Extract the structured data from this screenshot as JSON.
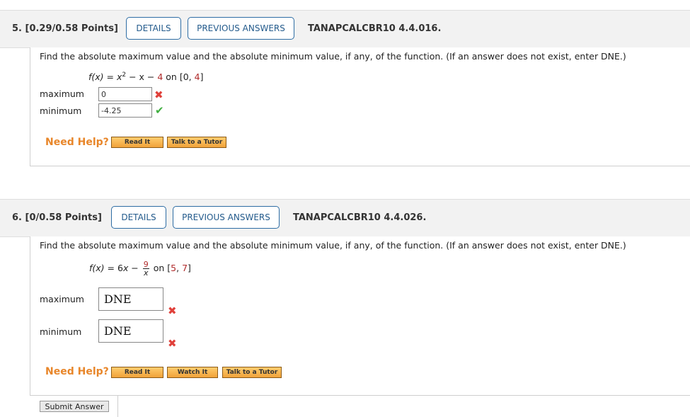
{
  "q5": {
    "number": "5. [0.29/0.58 Points]",
    "details_label": "DETAILS",
    "prev_label": "PREVIOUS ANSWERS",
    "code": "TANAPCALCBR10 4.4.016.",
    "prompt": "Find the absolute maximum value and the absolute minimum value, if any, of the function. (If an answer does not exist, enter DNE.)",
    "fn_prefix": "f(x) = x",
    "fn_exp": "2",
    "fn_mid": " − x − ",
    "fn_const": "4",
    "fn_on": " on [0, ",
    "fn_upper": "4",
    "fn_close": "]",
    "max_label": "maximum",
    "max_value": "0",
    "max_status": "incorrect",
    "min_label": "minimum",
    "min_value": "-4.25",
    "min_status": "correct",
    "need_help": "Need Help?",
    "read_it": "Read It",
    "tutor": "Talk to a Tutor"
  },
  "q6": {
    "number": "6. [0/0.58 Points]",
    "details_label": "DETAILS",
    "prev_label": "PREVIOUS ANSWERS",
    "code": "TANAPCALCBR10 4.4.026.",
    "prompt": "Find the absolute maximum value and the absolute minimum value, if any, of the function. (If an answer does not exist, enter DNE.)",
    "fn_prefix": "f(x) = ",
    "fn_coef": "6",
    "fn_x": "x − ",
    "fn_num": "9",
    "fn_den": "x",
    "fn_on": " on [",
    "fn_lower": "5",
    "fn_sep": ", ",
    "fn_upper": "7",
    "fn_close": "]",
    "max_label": "maximum",
    "max_value": "DNE",
    "max_status": "incorrect",
    "min_label": "minimum",
    "min_value": "DNE",
    "min_status": "incorrect",
    "need_help": "Need Help?",
    "read_it": "Read It",
    "watch_it": "Watch It",
    "tutor": "Talk to a Tutor",
    "submit": "Submit Answer"
  },
  "icons": {
    "incorrect": "x-mark-icon",
    "correct": "check-mark-icon"
  },
  "colors": {
    "incorrect": "#e0403a",
    "correct": "#3fae3f",
    "help": "#e8862a",
    "link": "#245b8c"
  }
}
